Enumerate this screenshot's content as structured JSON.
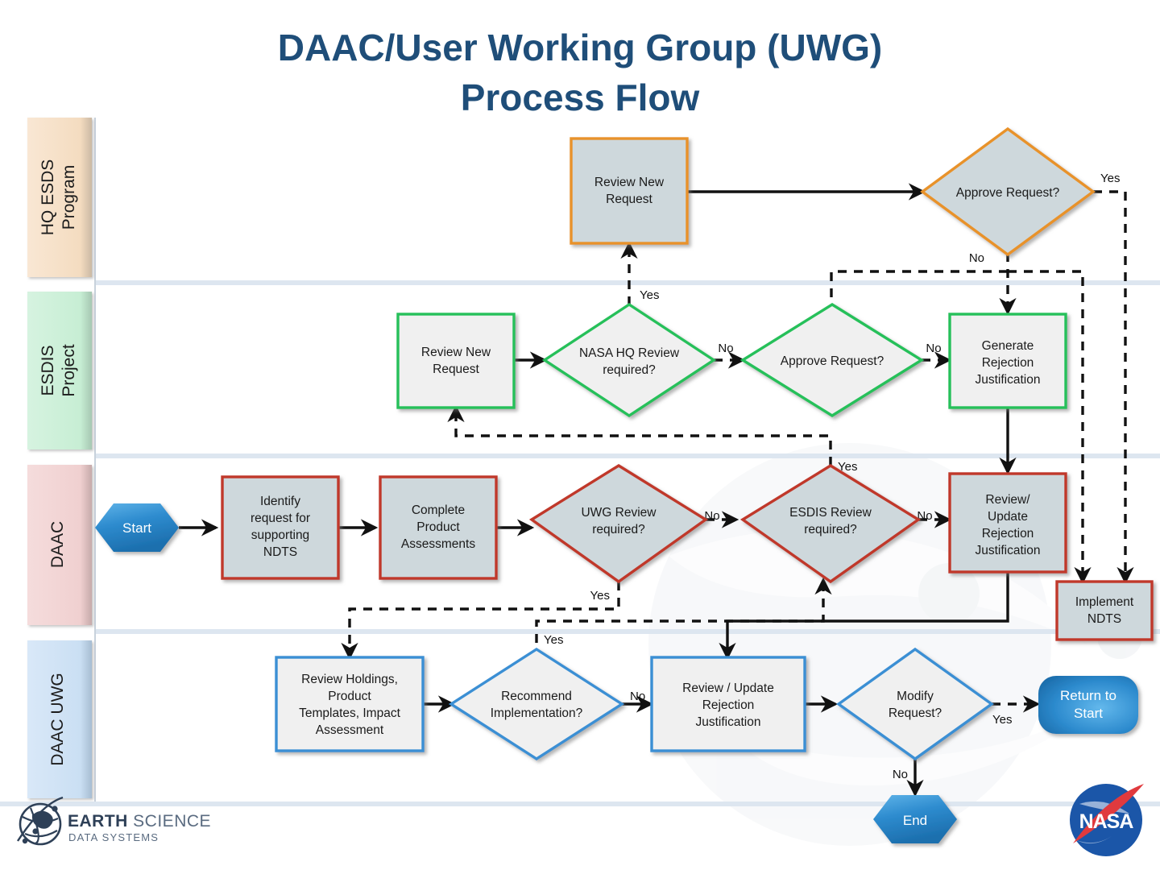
{
  "title": {
    "line1": "DAAC/User Working Group (UWG)",
    "line2": "Process Flow",
    "color": "#1f4e79"
  },
  "lanes": [
    {
      "id": "hq",
      "label": "HQ ESDS\nProgram",
      "label_l1": "HQ ESDS",
      "label_l2": "Program",
      "fill": "#f7e0c8",
      "accent": "#e8922c"
    },
    {
      "id": "esdis",
      "label": "ESDIS\nProject",
      "label_l1": "ESDIS",
      "label_l2": "Project",
      "fill": "#cdf0d8",
      "accent": "#27c05a"
    },
    {
      "id": "daac",
      "label": "DAAC",
      "label_l1": "DAAC",
      "label_l2": "",
      "fill": "#f2d3d3",
      "accent": "#c0392b"
    },
    {
      "id": "uwg",
      "label": "DAAC UWG",
      "label_l1": "DAAC UWG",
      "label_l2": "",
      "fill": "#cfe0f5",
      "accent": "#3b8fd4"
    }
  ],
  "palette": {
    "orange": "#e8922c",
    "green": "#27c05a",
    "red": "#c0392b",
    "blue": "#3b8fd4",
    "gray_fill": "#ced8dc",
    "light_fill": "#f0f0f0",
    "terminal_blue": "#2e8ccf",
    "line": "#111111"
  },
  "nodes": {
    "hq_review_new_request": {
      "label_l1": "Review New",
      "label_l2": "Request",
      "shape": "process",
      "lane": "hq",
      "border": "#e8922c",
      "fill": "#ced8dc"
    },
    "hq_approve_request": {
      "label_l1": "Approve Request?",
      "label_l2": "",
      "shape": "decision",
      "lane": "hq",
      "border": "#e8922c",
      "fill": "#ced8dc"
    },
    "esdis_review_new_request": {
      "label_l1": "Review New",
      "label_l2": "Request",
      "shape": "process",
      "lane": "esdis",
      "border": "#27c05a",
      "fill": "#f0f0f0"
    },
    "esdis_nasa_hq_review": {
      "label_l1": "NASA HQ Review",
      "label_l2": "required?",
      "shape": "decision",
      "lane": "esdis",
      "border": "#27c05a",
      "fill": "#f0f0f0"
    },
    "esdis_approve_request": {
      "label_l1": "Approve Request?",
      "label_l2": "",
      "shape": "decision",
      "lane": "esdis",
      "border": "#27c05a",
      "fill": "#f0f0f0"
    },
    "esdis_generate_rejection": {
      "label_l1": "Generate",
      "label_l2": "Rejection",
      "label_l3": "Justification",
      "shape": "process",
      "lane": "esdis",
      "border": "#27c05a",
      "fill": "#f0f0f0"
    },
    "daac_start": {
      "label_l1": "Start",
      "shape": "hexagon",
      "lane": "daac",
      "fill": "#2e8ccf"
    },
    "daac_identify_request": {
      "label_l1": "Identify",
      "label_l2": "request for",
      "label_l3": "supporting",
      "label_l4": "NDTS",
      "shape": "process",
      "lane": "daac",
      "border": "#c0392b",
      "fill": "#ced8dc"
    },
    "daac_complete_product": {
      "label_l1": "Complete",
      "label_l2": "Product",
      "label_l3": "Assessments",
      "shape": "process",
      "lane": "daac",
      "border": "#c0392b",
      "fill": "#ced8dc"
    },
    "daac_uwg_review_required": {
      "label_l1": "UWG Review",
      "label_l2": "required?",
      "shape": "decision",
      "lane": "daac",
      "border": "#c0392b",
      "fill": "#ced8dc"
    },
    "daac_esdis_review_required": {
      "label_l1": "ESDIS Review",
      "label_l2": "required?",
      "shape": "decision",
      "lane": "daac",
      "border": "#c0392b",
      "fill": "#ced8dc"
    },
    "daac_review_update_rejection": {
      "label_l1": "Review/",
      "label_l2": "Update",
      "label_l3": "Rejection",
      "label_l4": "Justification",
      "shape": "process",
      "lane": "daac",
      "border": "#c0392b",
      "fill": "#ced8dc"
    },
    "daac_implement_ndts": {
      "label_l1": "Implement",
      "label_l2": "NDTS",
      "shape": "process",
      "lane": "daac",
      "border": "#c0392b",
      "fill": "#ced8dc"
    },
    "uwg_review_holdings": {
      "label_l1": "Review Holdings,",
      "label_l2": "Product",
      "label_l3": "Templates, Impact",
      "label_l4": "Assessment",
      "shape": "process",
      "lane": "uwg",
      "border": "#3b8fd4",
      "fill": "#f0f0f0"
    },
    "uwg_recommend_impl": {
      "label_l1": "Recommend",
      "label_l2": "Implementation?",
      "shape": "decision",
      "lane": "uwg",
      "border": "#3b8fd4",
      "fill": "#f0f0f0"
    },
    "uwg_review_update_rejection": {
      "label_l1": "Review / Update",
      "label_l2": "Rejection",
      "label_l3": "Justification",
      "shape": "process",
      "lane": "uwg",
      "border": "#3b8fd4",
      "fill": "#f0f0f0"
    },
    "uwg_modify_request": {
      "label_l1": "Modify",
      "label_l2": "Request?",
      "shape": "decision",
      "lane": "uwg",
      "border": "#3b8fd4",
      "fill": "#f0f0f0"
    },
    "uwg_return_to_start": {
      "label_l1": "Return to",
      "label_l2": "Start",
      "shape": "rounded",
      "lane": "uwg",
      "fill": "#2e8ccf"
    },
    "uwg_end": {
      "label_l1": "End",
      "shape": "hexagon",
      "lane": "uwg",
      "fill": "#2e8ccf"
    }
  },
  "edge_labels": {
    "hq_approve_yes": "Yes",
    "hq_approve_no": "No",
    "esdis_hq_review_yes": "Yes",
    "esdis_hq_review_no": "No",
    "esdis_approve_no": "No",
    "daac_uwg_review_no": "No",
    "daac_uwg_review_yes": "Yes",
    "daac_esdis_review_yes": "Yes",
    "daac_esdis_review_no": "No",
    "uwg_recommend_yes": "Yes",
    "uwg_recommend_no": "No",
    "uwg_modify_yes": "Yes",
    "uwg_modify_no": "No"
  },
  "footer": {
    "esds_bold": "EARTH",
    "esds_normal": " SCIENCE",
    "esds_sub": "DATA SYSTEMS",
    "nasa": "NASA"
  }
}
